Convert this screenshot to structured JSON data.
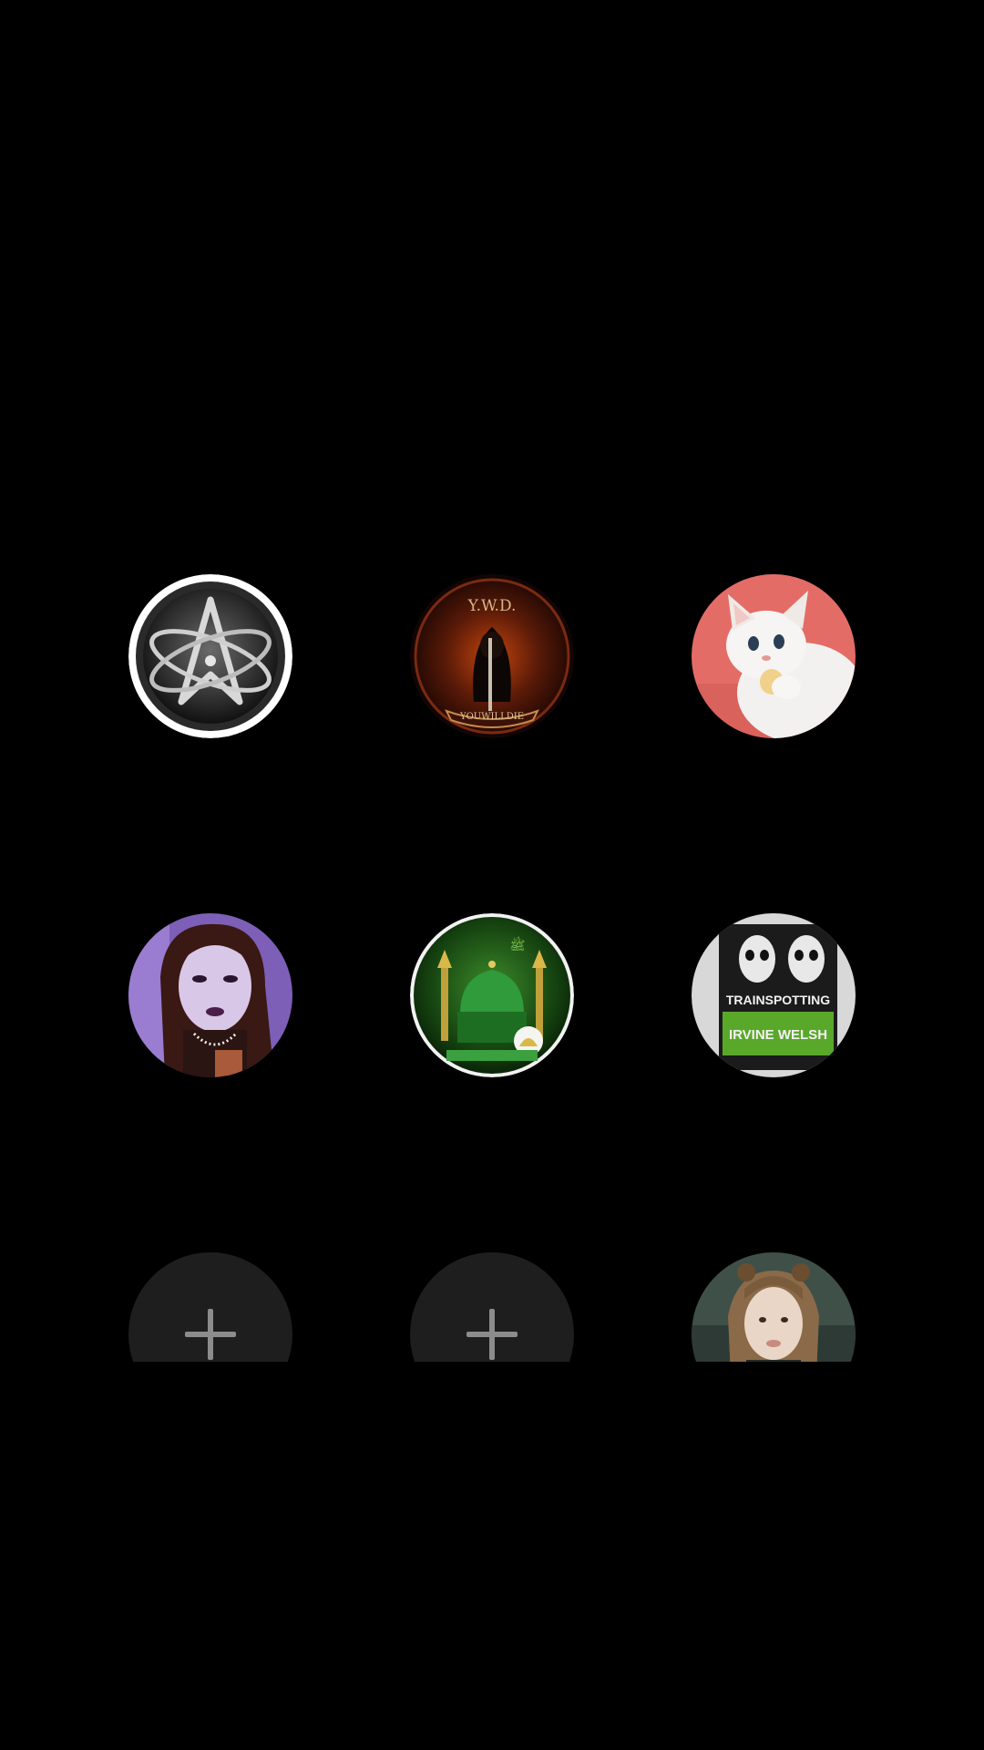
{
  "screen": {
    "background_color": "#000000"
  },
  "avatars": [
    {
      "id_label": "atheist-atom-symbol",
      "icon": "atom-symbol-icon",
      "kind": "image"
    },
    {
      "id_label": "ywd-emblem",
      "icon": "reaper-emblem-icon",
      "kind": "image",
      "text_top": "Y.W.D.",
      "text_bottom": "YOUWILLDIE"
    },
    {
      "id_label": "kitten-photo",
      "icon": "kitten-icon",
      "kind": "image"
    },
    {
      "id_label": "gothic-girl-photo",
      "icon": "person-photo-icon",
      "kind": "image"
    },
    {
      "id_label": "green-mosque-art",
      "icon": "mosque-icon",
      "kind": "image"
    },
    {
      "id_label": "trainspotting-book-cover",
      "icon": "book-cover-icon",
      "kind": "image",
      "text_title": "TRAINSPOTTING",
      "text_author": "IRVINE WELSH"
    },
    {
      "id_label": "add-slot-1",
      "icon": "plus-icon",
      "kind": "add"
    },
    {
      "id_label": "add-slot-2",
      "icon": "plus-icon",
      "kind": "add"
    },
    {
      "id_label": "girl-photo",
      "icon": "person-photo-icon",
      "kind": "image"
    }
  ]
}
